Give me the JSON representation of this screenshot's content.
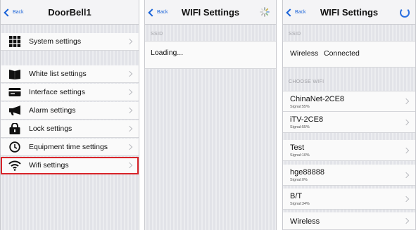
{
  "screen1": {
    "back_label": "Back",
    "title": "DoorBell1",
    "items": [
      {
        "label": "System settings",
        "icon": "grid-icon"
      },
      {
        "label": "White list settings",
        "icon": "book-icon"
      },
      {
        "label": "Interface settings",
        "icon": "card-icon"
      },
      {
        "label": "Alarm settings",
        "icon": "megaphone-icon"
      },
      {
        "label": "Lock settings",
        "icon": "lock-icon"
      },
      {
        "label": "Equipment time settings",
        "icon": "clock-icon"
      },
      {
        "label": "Wifi settings",
        "icon": "wifi-icon"
      }
    ],
    "highlight_color": "#d8242a"
  },
  "screen2": {
    "back_label": "Back",
    "title": "WIFI Settings",
    "ssid_header": "SSID",
    "status": "Loading..."
  },
  "screen3": {
    "back_label": "Back",
    "title": "WIFI Settings",
    "ssid_header": "SSID",
    "current_ssid": "Wireless",
    "current_status": "Connected",
    "choose_header": "CHOOSE WIFI",
    "networks": [
      {
        "name": "ChinaNet-2CE8",
        "signal": "Signal:55%"
      },
      {
        "name": "iTV-2CE8",
        "signal": "Signal:55%"
      },
      {
        "name": "Test",
        "signal": "Signal:10%"
      },
      {
        "name": "hge88888",
        "signal": "Signal:0%"
      },
      {
        "name": "B/T",
        "signal": "Signal:34%"
      },
      {
        "name": "Wireless",
        "signal": ""
      }
    ]
  },
  "accent_color": "#1a63d8"
}
